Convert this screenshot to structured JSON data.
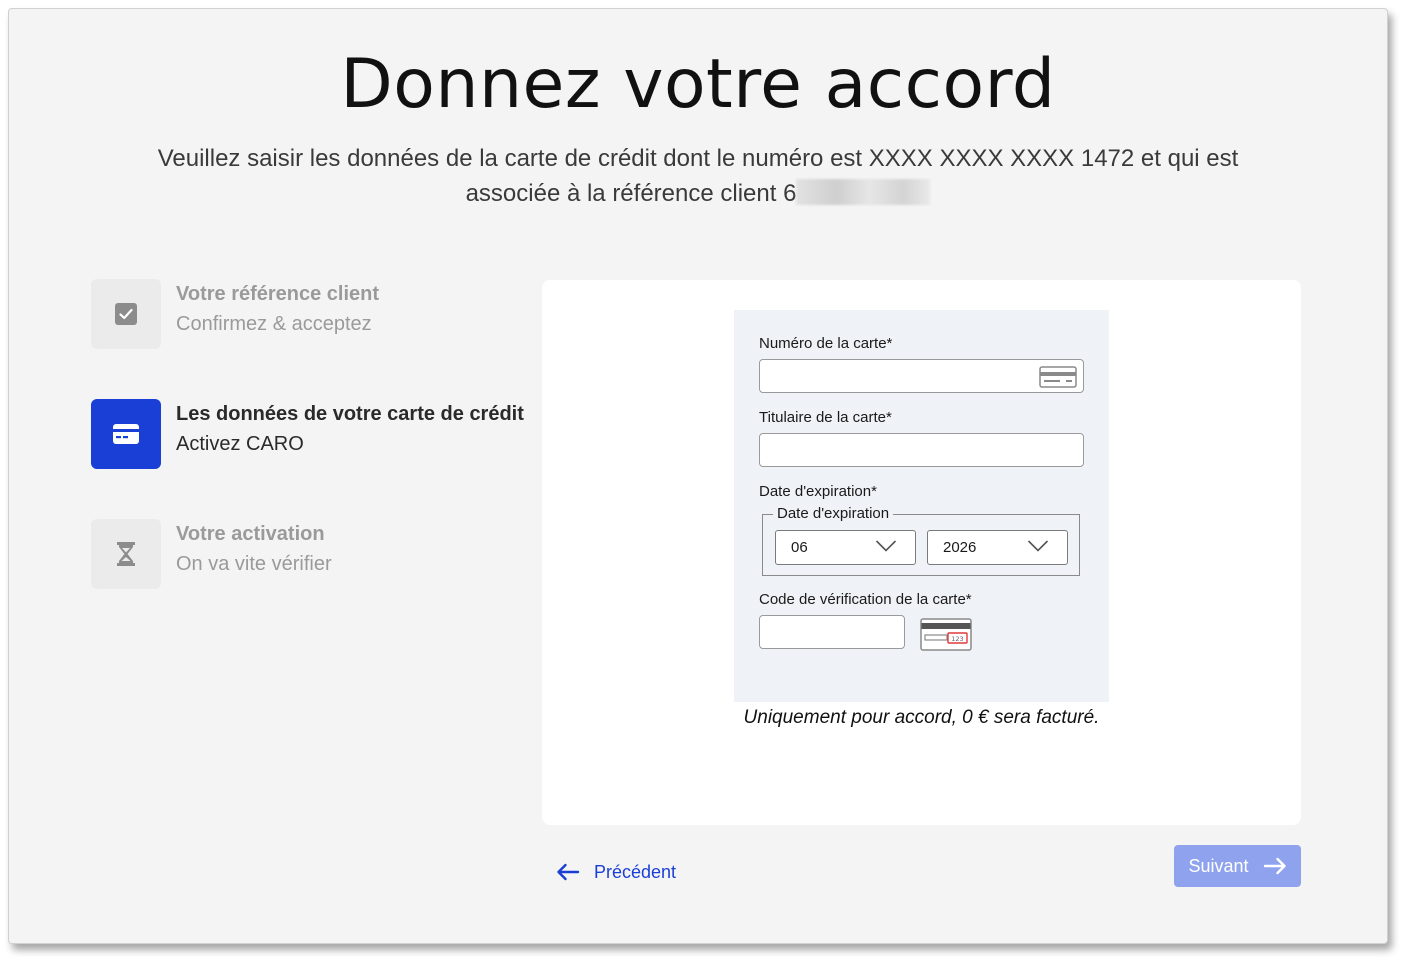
{
  "header": {
    "title": "Donnez votre accord",
    "subtitle_part1": "Veuillez saisir les données de la carte de crédit dont le numéro est XXXX XXXX XXXX 1472 et qui est associée à la référence client 6"
  },
  "steps": [
    {
      "title": "Votre référence client",
      "subtitle": "Confirmez & acceptez",
      "icon": "checkbox-icon",
      "state": "done"
    },
    {
      "title": "Les données de votre carte de crédit",
      "subtitle": "Activez CARO",
      "icon": "credit-card-icon",
      "state": "active"
    },
    {
      "title": "Votre activation",
      "subtitle": "On va vite vérifier",
      "icon": "hourglass-icon",
      "state": "pending"
    }
  ],
  "form": {
    "card_number_label": "Numéro de la carte*",
    "card_number_value": "",
    "holder_label": "Titulaire de la carte*",
    "holder_value": "",
    "expiry_label": "Date d'expiration*",
    "expiry_legend": "Date d'expiration",
    "expiry_month": "06",
    "expiry_year": "2026",
    "cvc_label": "Code de vérification de la carte*",
    "cvc_value": "",
    "cvc_hint": "123"
  },
  "note": "Uniquement pour accord, 0 € sera facturé.",
  "nav": {
    "prev_label": "Précédent",
    "next_label": "Suivant"
  },
  "colors": {
    "accent": "#1a3fd6",
    "next_disabled": "#8fa2ee",
    "background": "#f4f4f4",
    "form_bg": "#eff2f7"
  }
}
